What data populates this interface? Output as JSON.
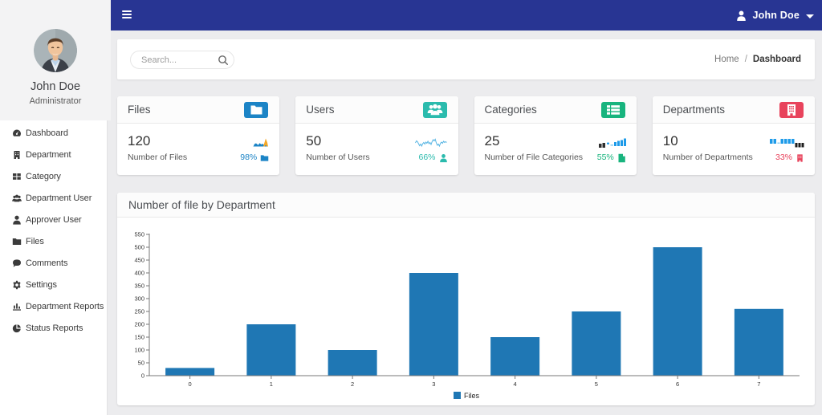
{
  "navbar": {
    "user_name": "John Doe"
  },
  "sidebar": {
    "user": {
      "name": "John Doe",
      "role": "Administrator"
    },
    "items": [
      {
        "icon": "tachometer-icon",
        "label": "Dashboard"
      },
      {
        "icon": "building-icon",
        "label": "Department"
      },
      {
        "icon": "th-large-icon",
        "label": "Category"
      },
      {
        "icon": "users-icon",
        "label": "Department User"
      },
      {
        "icon": "user-icon",
        "label": "Approver User"
      },
      {
        "icon": "folder-icon",
        "label": "Files"
      },
      {
        "icon": "comment-icon",
        "label": "Comments"
      },
      {
        "icon": "gear-icon",
        "label": "Settings"
      },
      {
        "icon": "chart-bar-icon",
        "label": "Department Reports"
      },
      {
        "icon": "chart-pie-icon",
        "label": "Status Reports"
      }
    ]
  },
  "toolbar": {
    "search_placeholder": "Search...",
    "breadcrumb": {
      "home": "Home",
      "separator": "/",
      "current": "Dashboard"
    }
  },
  "stats": [
    {
      "title": "Files",
      "badge_icon": "folder-icon",
      "color": "#1c84c6",
      "value": "120",
      "label": "Number of Files",
      "percent": "98%",
      "footer_icon": "folder-icon",
      "spark": "area-blue"
    },
    {
      "title": "Users",
      "badge_icon": "users-icon",
      "color": "#2bbbad",
      "value": "50",
      "label": "Number of Users",
      "percent": "66%",
      "footer_icon": "user-icon",
      "spark": "line-cyan"
    },
    {
      "title": "Categories",
      "badge_icon": "list-icon",
      "color": "#18b47e",
      "value": "25",
      "label": "Number of File Categories",
      "percent": "55%",
      "footer_icon": "file-icon",
      "spark": "bars-mixed"
    },
    {
      "title": "Departments",
      "badge_icon": "building-icon",
      "color": "#e8435c",
      "value": "10",
      "label": "Number of Departments",
      "percent": "33%",
      "footer_icon": "building-icon",
      "spark": "bars-blue-black"
    }
  ],
  "chart_card": {
    "title": "Number of file by Department"
  },
  "chart_data": {
    "type": "bar",
    "title": "Number of file by Department",
    "categories": [
      "0",
      "1",
      "2",
      "3",
      "4",
      "5",
      "6",
      "7"
    ],
    "series": [
      {
        "name": "Files",
        "values": [
          30,
          200,
          100,
          400,
          150,
          250,
          500,
          260
        ]
      }
    ],
    "xlabel": "",
    "ylabel": "",
    "ylim": [
      0,
      550
    ],
    "ytick_step": 50,
    "bar_color": "#1f77b4",
    "axis_color": "#777777",
    "grid": false,
    "legend_position": "bottom"
  },
  "colors": {
    "navbar": "#283593",
    "page_background": "#ececee",
    "files_accent": "#1c84c6",
    "users_accent": "#2bbbad",
    "categories_accent": "#18b47e",
    "departments_accent": "#e8435c"
  }
}
